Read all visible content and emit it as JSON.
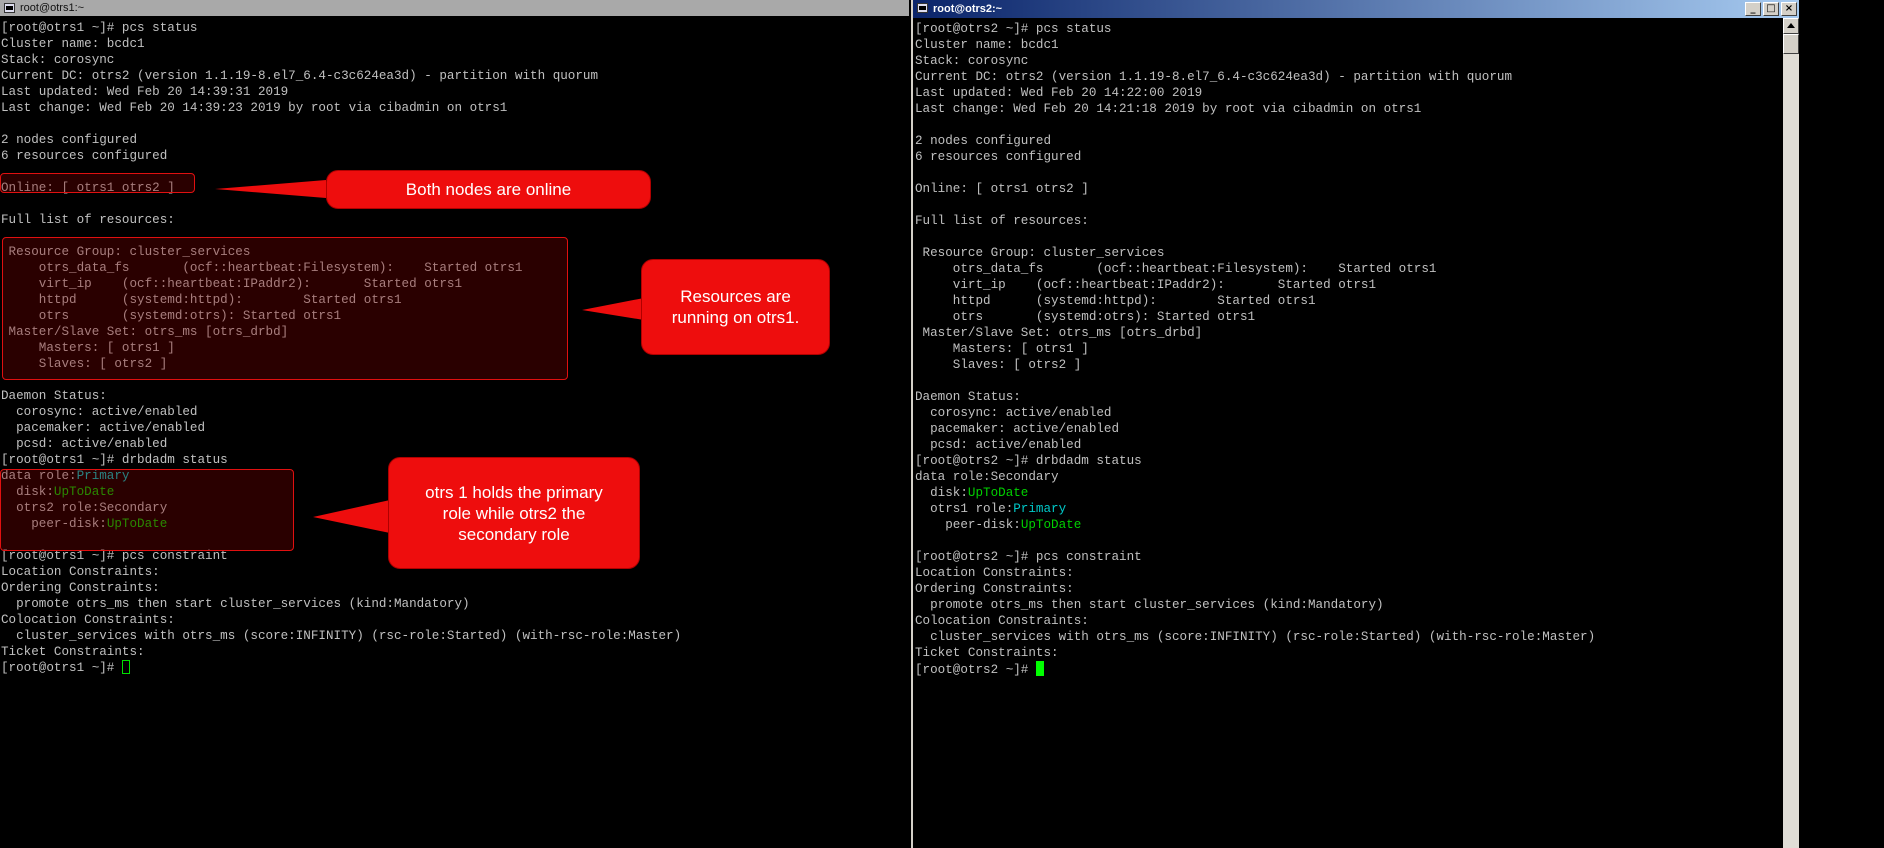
{
  "window1": {
    "title": "root@otrs1:~",
    "lines": [
      "[root@otrs1 ~]# pcs status",
      "Cluster name: bcdc1",
      "Stack: corosync",
      "Current DC: otrs2 (version 1.1.19-8.el7_6.4-c3c624ea3d) - partition with quorum",
      "Last updated: Wed Feb 20 14:39:31 2019",
      "Last change: Wed Feb 20 14:39:23 2019 by root via cibadmin on otrs1",
      "",
      "2 nodes configured",
      "6 resources configured",
      "",
      "Online: [ otrs1 otrs2 ]",
      "",
      "Full list of resources:",
      "",
      " Resource Group: cluster_services",
      "     otrs_data_fs       (ocf::heartbeat:Filesystem):    Started otrs1",
      "     virt_ip    (ocf::heartbeat:IPaddr2):       Started otrs1",
      "     httpd      (systemd:httpd):        Started otrs1",
      "     otrs       (systemd:otrs): Started otrs1",
      " Master/Slave Set: otrs_ms [otrs_drbd]",
      "     Masters: [ otrs1 ]",
      "     Slaves: [ otrs2 ]",
      "",
      "Daemon Status:",
      "  corosync: active/enabled",
      "  pacemaker: active/enabled",
      "  pcsd: active/enabled",
      "[root@otrs1 ~]# drbdadm status"
    ],
    "drbd": {
      "l1_prefix": "data role:",
      "l1_value": "Primary",
      "l2_prefix": "  disk:",
      "l2_value": "UpToDate",
      "l3": "  otrs2 role:Secondary",
      "l4_prefix": "    peer-disk:",
      "l4_value": "UpToDate"
    },
    "lines_after": [
      "",
      "[root@otrs1 ~]# pcs constraint",
      "Location Constraints:",
      "Ordering Constraints:",
      "  promote otrs_ms then start cluster_services (kind:Mandatory)",
      "Colocation Constraints:",
      "  cluster_services with otrs_ms (score:INFINITY) (rsc-role:Started) (with-rsc-role:Master)",
      "Ticket Constraints:"
    ],
    "prompt": "[root@otrs1 ~]# "
  },
  "window2": {
    "title": "root@otrs2:~",
    "lines": [
      "[root@otrs2 ~]# pcs status",
      "Cluster name: bcdc1",
      "Stack: corosync",
      "Current DC: otrs2 (version 1.1.19-8.el7_6.4-c3c624ea3d) - partition with quorum",
      "Last updated: Wed Feb 20 14:22:00 2019",
      "Last change: Wed Feb 20 14:21:18 2019 by root via cibadmin on otrs1",
      "",
      "2 nodes configured",
      "6 resources configured",
      "",
      "Online: [ otrs1 otrs2 ]",
      "",
      "Full list of resources:",
      "",
      " Resource Group: cluster_services",
      "     otrs_data_fs       (ocf::heartbeat:Filesystem):    Started otrs1",
      "     virt_ip    (ocf::heartbeat:IPaddr2):       Started otrs1",
      "     httpd      (systemd:httpd):        Started otrs1",
      "     otrs       (systemd:otrs): Started otrs1",
      " Master/Slave Set: otrs_ms [otrs_drbd]",
      "     Masters: [ otrs1 ]",
      "     Slaves: [ otrs2 ]",
      "",
      "Daemon Status:",
      "  corosync: active/enabled",
      "  pacemaker: active/enabled",
      "  pcsd: active/enabled",
      "[root@otrs2 ~]# drbdadm status"
    ],
    "drbd": {
      "l1": "data role:Secondary",
      "l2_prefix": "  disk:",
      "l2_value": "UpToDate",
      "l3_prefix": "  otrs1 role:",
      "l3_value": "Primary",
      "l4_prefix": "    peer-disk:",
      "l4_value": "UpToDate"
    },
    "lines_after": [
      "",
      "[root@otrs2 ~]# pcs constraint",
      "Location Constraints:",
      "Ordering Constraints:",
      "  promote otrs_ms then start cluster_services (kind:Mandatory)",
      "Colocation Constraints:",
      "  cluster_services with otrs_ms (score:INFINITY) (rsc-role:Started) (with-rsc-role:Master)",
      "Ticket Constraints:"
    ],
    "prompt": "[root@otrs2 ~]# "
  },
  "callouts": {
    "nodes_online": "Both nodes are online",
    "resources_running": "Resources are running on otrs1.",
    "primary_role": "otrs 1 holds the primary role while otrs2 the secondary role"
  },
  "colors": {
    "terminal_bg": "#000000",
    "terminal_text": "#c0c0c0",
    "cyan": "#00c8c8",
    "green": "#00d000",
    "callout_red": "#ee0d0d"
  }
}
